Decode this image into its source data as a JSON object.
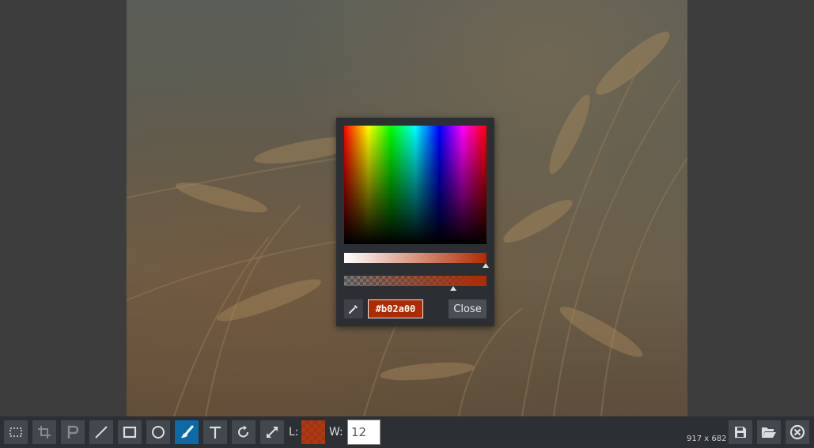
{
  "toolbar": {
    "tools": [
      {
        "name": "select-tool",
        "icon": "select-rectangle-icon",
        "active": false,
        "disabled": false
      },
      {
        "name": "crop-tool",
        "icon": "crop-icon",
        "active": false,
        "disabled": true
      },
      {
        "name": "pixelate-tool",
        "icon": "pixelate-icon",
        "active": false,
        "disabled": true
      },
      {
        "name": "line-tool",
        "icon": "line-icon",
        "active": false,
        "disabled": false
      },
      {
        "name": "rectangle-tool",
        "icon": "rectangle-icon",
        "active": false,
        "disabled": false
      },
      {
        "name": "ellipse-tool",
        "icon": "ellipse-icon",
        "active": false,
        "disabled": false
      },
      {
        "name": "brush-tool",
        "icon": "brush-icon",
        "active": true,
        "disabled": false
      },
      {
        "name": "text-tool",
        "icon": "text-icon",
        "active": false,
        "disabled": false
      },
      {
        "name": "rotate-tool",
        "icon": "rotate-icon",
        "active": false,
        "disabled": false
      },
      {
        "name": "resize-tool",
        "icon": "resize-icon",
        "active": false,
        "disabled": false
      }
    ],
    "line_color_label": "L:",
    "width_label": "W:",
    "width_value": "12",
    "image_dimensions": "917 x 682",
    "actions": [
      {
        "name": "save-button",
        "icon": "save-icon"
      },
      {
        "name": "open-button",
        "icon": "folder-open-icon"
      },
      {
        "name": "close-editor-button",
        "icon": "close-circle-icon"
      }
    ]
  },
  "color_picker": {
    "hex_value": "#b02a00",
    "close_label": "Close",
    "selected_color": "#b02a00",
    "lightness_level": 1.0,
    "alpha_level": 0.8
  },
  "colors": {
    "accent_active": "#0c6aa6",
    "toolbar_bg": "#2c3035",
    "workspace_bg": "#3d3d3d"
  }
}
